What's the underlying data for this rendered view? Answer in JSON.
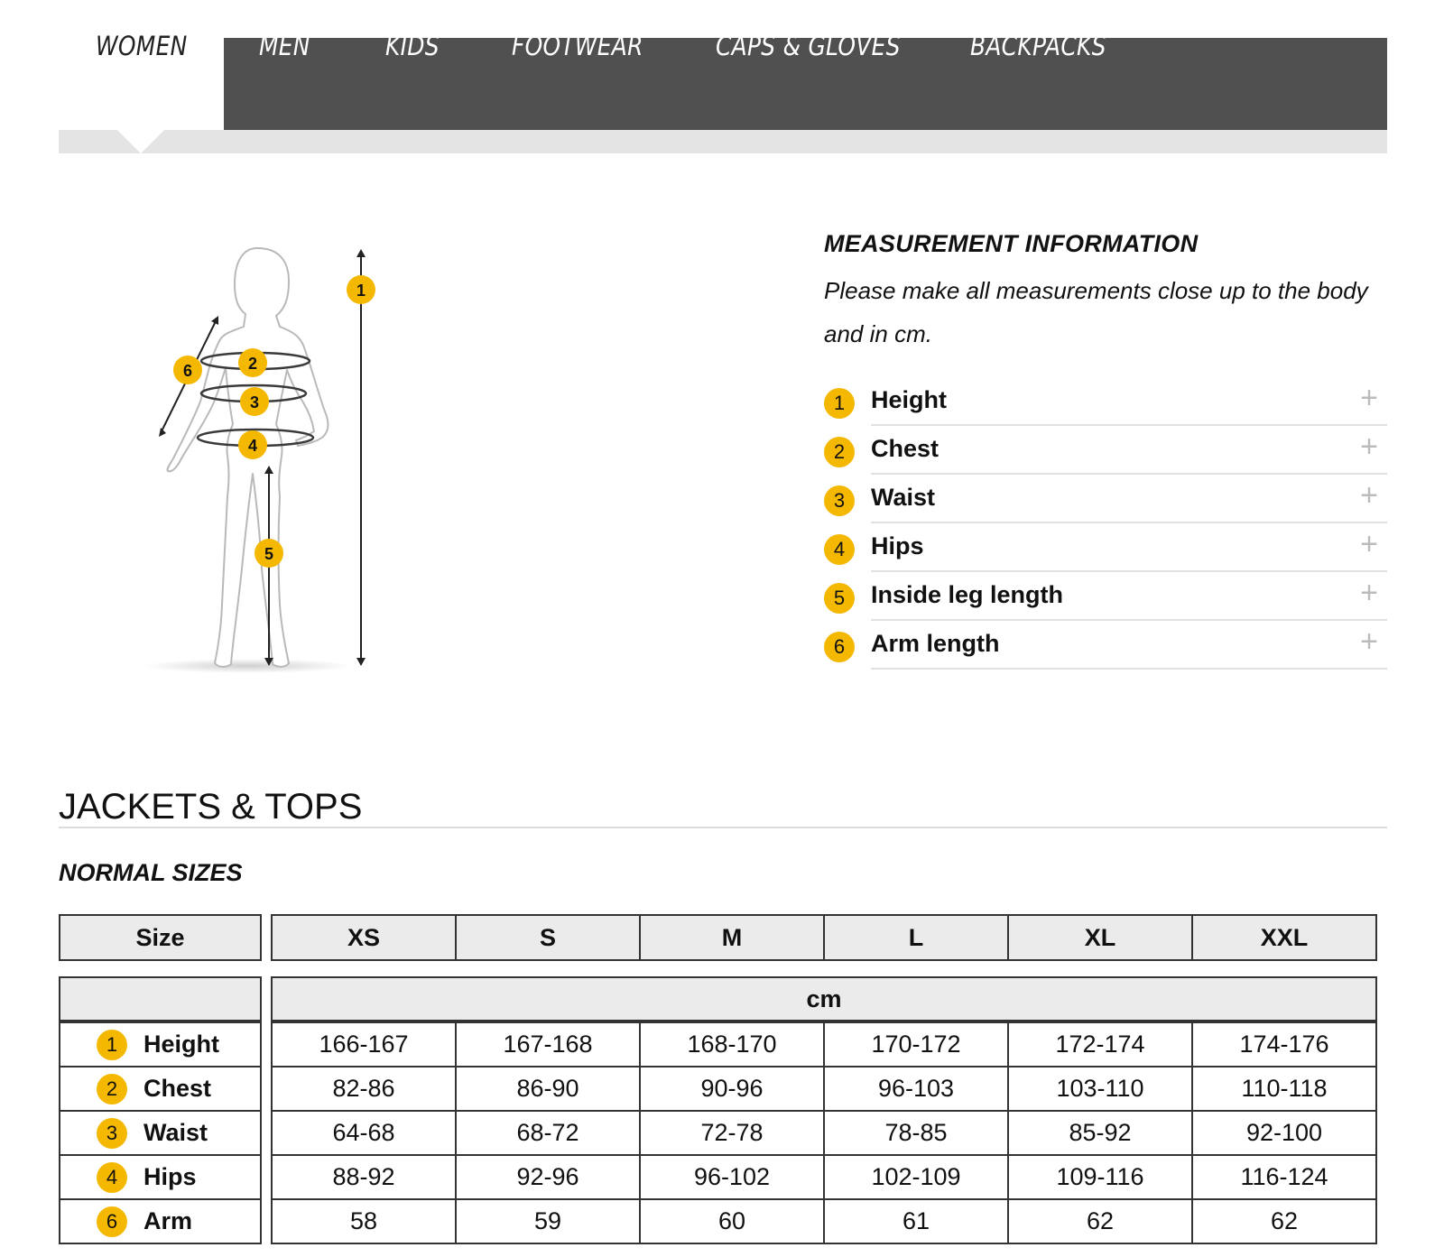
{
  "tabs": [
    {
      "label": "WOMEN",
      "active": true
    },
    {
      "label": "MEN",
      "active": false
    },
    {
      "label": "KIDS",
      "active": false
    },
    {
      "label": "FOOTWEAR",
      "active": false
    },
    {
      "label": "CAPS & GLOVES",
      "active": false
    },
    {
      "label": "BACKPACKS",
      "active": false
    }
  ],
  "figure": {
    "markers": [
      "1",
      "2",
      "3",
      "4",
      "5",
      "6"
    ]
  },
  "info": {
    "title": "MEASUREMENT INFORMATION",
    "description": "Please make all measurements close up to the body and in cm.",
    "items": [
      {
        "num": "1",
        "label": "Height"
      },
      {
        "num": "2",
        "label": "Chest"
      },
      {
        "num": "3",
        "label": "Waist"
      },
      {
        "num": "4",
        "label": "Hips"
      },
      {
        "num": "5",
        "label": "Inside leg length"
      },
      {
        "num": "6",
        "label": "Arm length"
      }
    ],
    "expand_symbol": "+"
  },
  "section": {
    "title": "JACKETS & TOPS",
    "subtitle": "NORMAL SIZES"
  },
  "table": {
    "size_header": "Size",
    "sizes": [
      "XS",
      "S",
      "M",
      "L",
      "XL",
      "XXL"
    ],
    "unit": "cm",
    "rows": [
      {
        "num": "1",
        "label": "Height",
        "values": [
          "166-167",
          "167-168",
          "168-170",
          "170-172",
          "172-174",
          "174-176"
        ]
      },
      {
        "num": "2",
        "label": "Chest",
        "values": [
          "82-86",
          "86-90",
          "90-96",
          "96-103",
          "103-110",
          "110-118"
        ]
      },
      {
        "num": "3",
        "label": "Waist",
        "values": [
          "64-68",
          "68-72",
          "72-78",
          "78-85",
          "85-92",
          "92-100"
        ]
      },
      {
        "num": "4",
        "label": "Hips",
        "values": [
          "88-92",
          "92-96",
          "96-102",
          "102-109",
          "109-116",
          "116-124"
        ]
      },
      {
        "num": "6",
        "label": "Arm",
        "values": [
          "58",
          "59",
          "60",
          "61",
          "62",
          "62"
        ]
      }
    ]
  },
  "colors": {
    "tab_bar": "#505050",
    "badge": "#f5b800",
    "header_bg": "#ebebeb"
  }
}
